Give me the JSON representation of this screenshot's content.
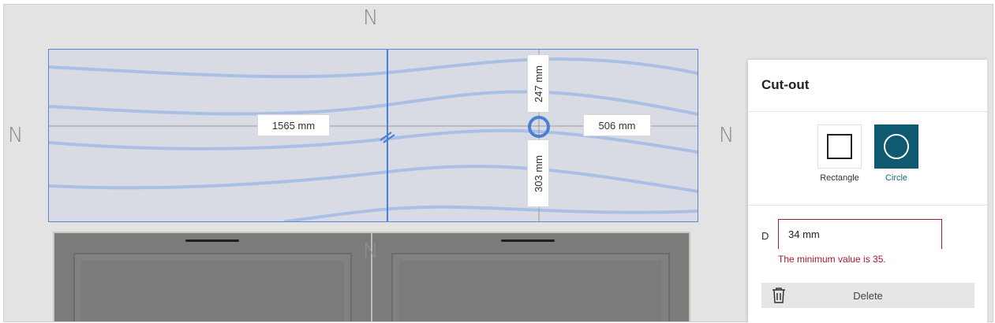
{
  "compass_glyph": "N",
  "dimensions": {
    "left_width": "1565 mm",
    "right_width": "506 mm",
    "top_depth": "247 mm",
    "bottom_depth": "303 mm"
  },
  "cutout_panel": {
    "title": "Cut-out",
    "shapes": [
      {
        "id": "rectangle",
        "label": "Rectangle",
        "icon": "square-outline-icon",
        "selected": false
      },
      {
        "id": "circle",
        "label": "Circle",
        "icon": "circle-outline-icon",
        "selected": true
      }
    ],
    "diameter": {
      "label": "D",
      "value": "34 mm",
      "error": "The minimum value is 35."
    },
    "delete_label": "Delete"
  },
  "colors": {
    "accent": "#0f5a70",
    "error": "#a31a2f",
    "outline": "#5b86d6"
  }
}
